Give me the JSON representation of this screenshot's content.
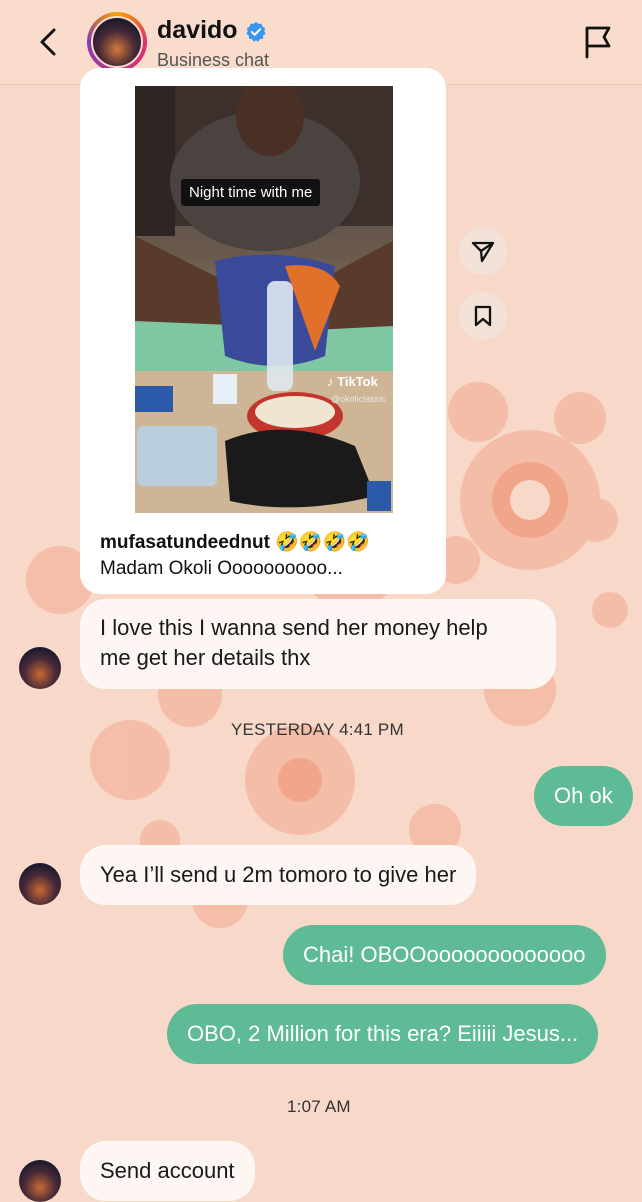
{
  "header": {
    "back_icon": "chevron-left-icon",
    "name": "davido",
    "verified_icon": "verified-badge-icon",
    "subtitle": "Business chat",
    "flag_icon": "flag-icon"
  },
  "shared_post": {
    "video_caption": "Night time with me",
    "watermark": "TikTok",
    "watermark_handle": "@okoliclassic",
    "username": "mufasatundeednut",
    "emojis": "🤣🤣🤣🤣",
    "text": "Madam Okoli Oooooooooo...",
    "share_icon": "send-icon",
    "save_icon": "bookmark-icon"
  },
  "messages": [
    {
      "side": "in",
      "text_line1": "I love this I wanna send her money help",
      "text_line2": "me get her details thx"
    },
    {
      "type": "time",
      "text": "YESTERDAY 4:41 PM"
    },
    {
      "side": "out",
      "text": "Oh ok"
    },
    {
      "side": "in",
      "text": "Yea I’ll send u 2m tomoro to give her"
    },
    {
      "side": "out",
      "text": "Chai! OBOOooooooooooooo"
    },
    {
      "side": "out",
      "text": "OBO, 2 Million for this era? Eiiiii Jesus..."
    },
    {
      "type": "time",
      "text": "1:07 AM"
    },
    {
      "side": "in",
      "text": "Send account"
    }
  ],
  "colors": {
    "background": "#f8d9c9",
    "outgoing_bubble": "#5fba96",
    "incoming_bubble": "#fdf6f2",
    "verified": "#3797f0"
  }
}
